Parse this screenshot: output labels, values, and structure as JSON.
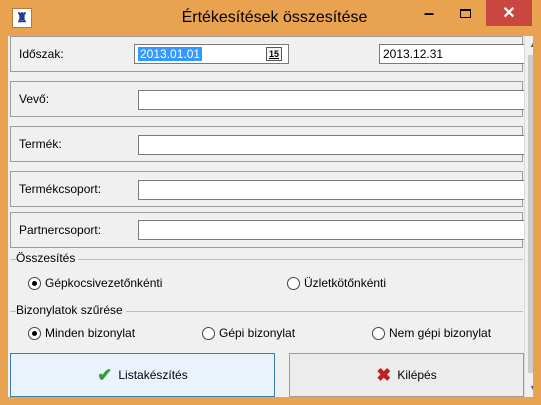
{
  "window": {
    "title": "Értékesítések összesítése"
  },
  "controls": {
    "minimize": "–",
    "close": "✕"
  },
  "period": {
    "label": "Időszak:",
    "from": "2013.01.01",
    "to": "2013.12.31",
    "calendar_glyph": "15"
  },
  "fields": {
    "customer": {
      "label": "Vevő:",
      "value": ""
    },
    "product": {
      "label": "Termék:",
      "value": ""
    },
    "product_group": {
      "label": "Termékcsoport:",
      "value": ""
    },
    "partner_group": {
      "label": "Partnercsoport:",
      "value": ""
    }
  },
  "summary": {
    "legend": "Összesítés",
    "options": [
      {
        "label": "Gépkocsivezetőnkénti",
        "selected": true
      },
      {
        "label": "Üzletkötőnkénti",
        "selected": false
      }
    ]
  },
  "filter": {
    "legend": "Bizonylatok szűrése",
    "options": [
      {
        "label": "Minden bizonylat",
        "selected": true
      },
      {
        "label": "Gépi bizonylat",
        "selected": false
      },
      {
        "label": "Nem gépi bizonylat",
        "selected": false
      }
    ]
  },
  "buttons": {
    "list": "Listakészítés",
    "exit": "Kilépés"
  },
  "colors": {
    "titlebar": "#e9a24f",
    "close": "#c9473e",
    "selection": "#3399ff",
    "check": "#2f9e2f",
    "exit_x": "#c02020"
  }
}
